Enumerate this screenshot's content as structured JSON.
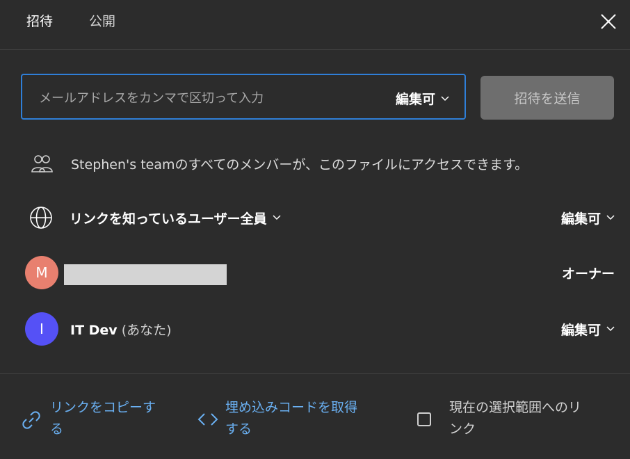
{
  "tabs": [
    {
      "label": "招待",
      "active": true
    },
    {
      "label": "公開",
      "active": false
    }
  ],
  "invite": {
    "placeholder": "メールアドレスをカンマで区切って入力",
    "value": "",
    "permission": "編集可",
    "send_label": "招待を送信"
  },
  "team_notice": "Stephen's teamのすべてのメンバーが、このファイルにアクセスできます。",
  "link_access": {
    "label": "リンクを知っているユーザー全員",
    "permission": "編集可"
  },
  "members": [
    {
      "initial": "M",
      "name": "",
      "role": "オーナー",
      "avatar_color": "#e8806f"
    },
    {
      "initial": "I",
      "name": "IT Dev",
      "suffix": "(あなた)",
      "role": "編集可",
      "avatar_color": "#5551f6"
    }
  ],
  "footer": {
    "copy_link": [
      "リンクをコピーす",
      "る"
    ],
    "embed": [
      "埋め込みコードを取得",
      "する"
    ],
    "selection_link": [
      "現在の選択範囲へのリ",
      "ンク"
    ]
  },
  "colors": {
    "background": "#2c2c2c",
    "accent": "#2f7fd8",
    "link": "#6ab0f2"
  }
}
